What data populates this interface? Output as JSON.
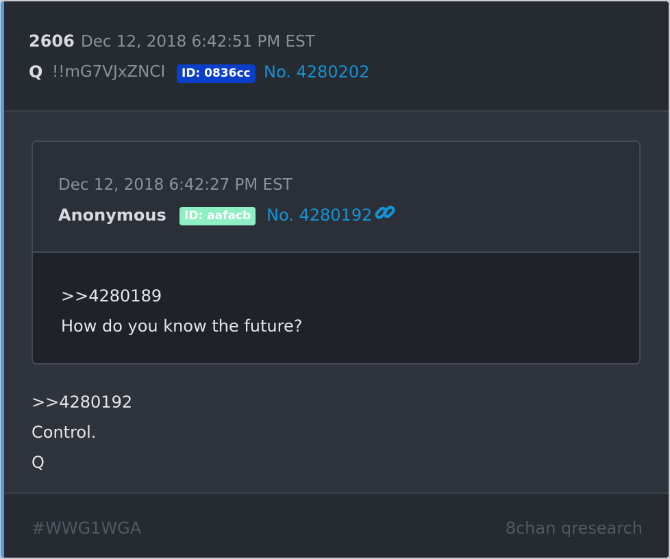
{
  "post": {
    "number": "2606",
    "date": "Dec 12, 2018 6:42:51 PM EST",
    "author": "Q",
    "tripcode": "!!mG7VJxZNCI",
    "id_badge": "ID: 0836cc",
    "post_link": "No. 4280202",
    "body_lines": [
      ">>4280192",
      "Control.",
      "Q"
    ]
  },
  "quoted": {
    "date": "Dec 12, 2018 6:42:27 PM EST",
    "author": "Anonymous",
    "id_badge": "ID: aafacb",
    "post_link": "No. 4280192",
    "link_icon": "link-icon",
    "body_lines": [
      ">>4280189",
      "How do you know the future?"
    ]
  },
  "footer": {
    "hashtag": "#WWG1WGA",
    "source": "8chan qresearch"
  },
  "colors": {
    "accent_bar": "#4a9fe6",
    "link": "#1592d6",
    "q_id_badge": "#0a3fc9",
    "anon_id_badge": "#8ef0c2"
  }
}
